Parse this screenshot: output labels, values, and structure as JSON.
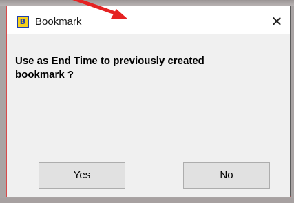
{
  "dialog": {
    "title": "Bookmark",
    "icon": "app-icon",
    "icon_glyph": "B",
    "close_label": "✕",
    "message": "Use as End Time to previously created bookmark ?",
    "buttons": {
      "yes": "Yes",
      "no": "No"
    }
  },
  "colors": {
    "dialog_border": "#d84a4a",
    "dialog_background": "#f0f0f0",
    "title_background": "#ffffff",
    "icon_background": "#f6d11c",
    "icon_foreground": "#1f3fb1",
    "annotation_arrow": "#e52222"
  }
}
